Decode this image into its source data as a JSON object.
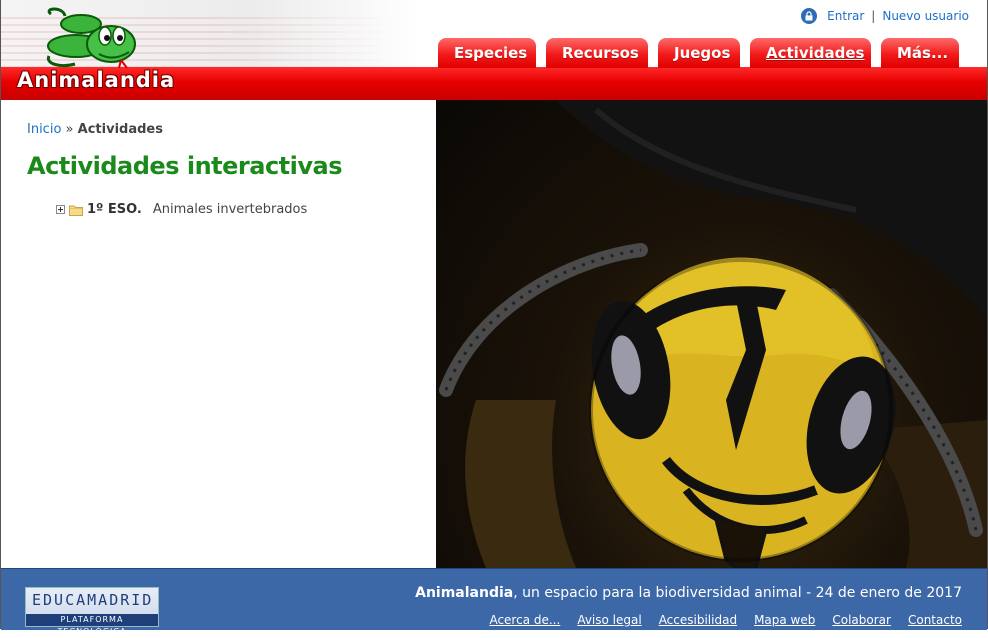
{
  "header": {
    "logo_text": "Animalandia",
    "user_links": {
      "login": "Entrar",
      "separator": "|",
      "register": "Nuevo usuario"
    },
    "tabs": [
      {
        "label": "Especies"
      },
      {
        "label": "Recursos"
      },
      {
        "label": "Juegos"
      },
      {
        "label": "Actividades",
        "active": true
      },
      {
        "label": "Más..."
      }
    ]
  },
  "breadcrumb": {
    "home": "Inicio",
    "separator": "»",
    "current": "Actividades"
  },
  "main": {
    "title": "Actividades interactivas",
    "tree": [
      {
        "course": "1º ESO.",
        "topic": "Animales invertebrados"
      }
    ]
  },
  "footer": {
    "partner_logo_text": "EDUCAMADRID",
    "partner_logo_subtext": "PLATAFORMA TECNOLÓGICA",
    "brand": "Animalandia",
    "tagline": ", un espacio para la biodiversidad animal - 24 de enero de 2017",
    "links": [
      "Acerca de...",
      "Aviso legal",
      "Accesibilidad",
      "Mapa web",
      "Colaborar",
      "Contacto"
    ]
  },
  "icons": [
    "snake-logo-icon",
    "lock-icon",
    "expand-icon",
    "folder-icon"
  ],
  "colors": {
    "header_red": "#e80000",
    "title_green": "#1a8a1a",
    "link_blue": "#1e6fc8",
    "footer_blue": "#3c68a8"
  }
}
